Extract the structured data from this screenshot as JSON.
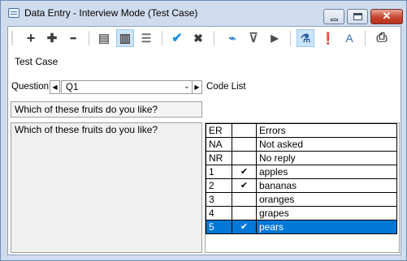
{
  "window": {
    "title": "Data Entry - Interview Mode (Test Case)",
    "close_glyph": "✕"
  },
  "toolbar": {
    "buttons": [
      {
        "name": "add-icon",
        "glyph": "+"
      },
      {
        "name": "add-multiple-icon",
        "glyph": "✚"
      },
      {
        "name": "remove-icon",
        "glyph": "━"
      },
      {
        "name": "form-view-icon",
        "glyph": "▤"
      },
      {
        "name": "split-view-icon",
        "glyph": "▥",
        "active": true
      },
      {
        "name": "list-view-icon",
        "glyph": "☰"
      },
      {
        "name": "accept-icon",
        "glyph": "✔"
      },
      {
        "name": "reject-icon",
        "glyph": "✖"
      },
      {
        "name": "clear-icon",
        "glyph": "⌁"
      },
      {
        "name": "filter-icon",
        "glyph": "⊽"
      },
      {
        "name": "run-icon",
        "glyph": "▶"
      },
      {
        "name": "test-icon",
        "glyph": "⚗",
        "active": true
      },
      {
        "name": "error-icon",
        "glyph": "❗"
      },
      {
        "name": "spellcheck-icon",
        "glyph": "A"
      },
      {
        "name": "print-icon",
        "glyph": "⎙"
      }
    ]
  },
  "document": {
    "label": "Test Case"
  },
  "question": {
    "label": "Question",
    "value": "Q1",
    "prev_glyph": "◀",
    "next_glyph": "▶",
    "dropdown_glyph": "⌄",
    "text": "Which of these fruits do you like?",
    "detail_text": "Which of these fruits do you like?"
  },
  "code_list": {
    "label": "Code List",
    "check_glyph": "✔",
    "rows": [
      {
        "code": "ER",
        "checked": "",
        "label": "Errors",
        "selected": false
      },
      {
        "code": "NA",
        "checked": "",
        "label": "Not asked",
        "selected": false
      },
      {
        "code": "NR",
        "checked": "",
        "label": "No reply",
        "selected": false
      },
      {
        "code": "1",
        "checked": "✔",
        "label": "apples",
        "selected": false
      },
      {
        "code": "2",
        "checked": "✔",
        "label": "bananas",
        "selected": false
      },
      {
        "code": "3",
        "checked": "",
        "label": "oranges",
        "selected": false
      },
      {
        "code": "4",
        "checked": "",
        "label": "grapes",
        "selected": false
      },
      {
        "code": "5",
        "checked": "✔",
        "label": "pears",
        "selected": true
      }
    ]
  }
}
